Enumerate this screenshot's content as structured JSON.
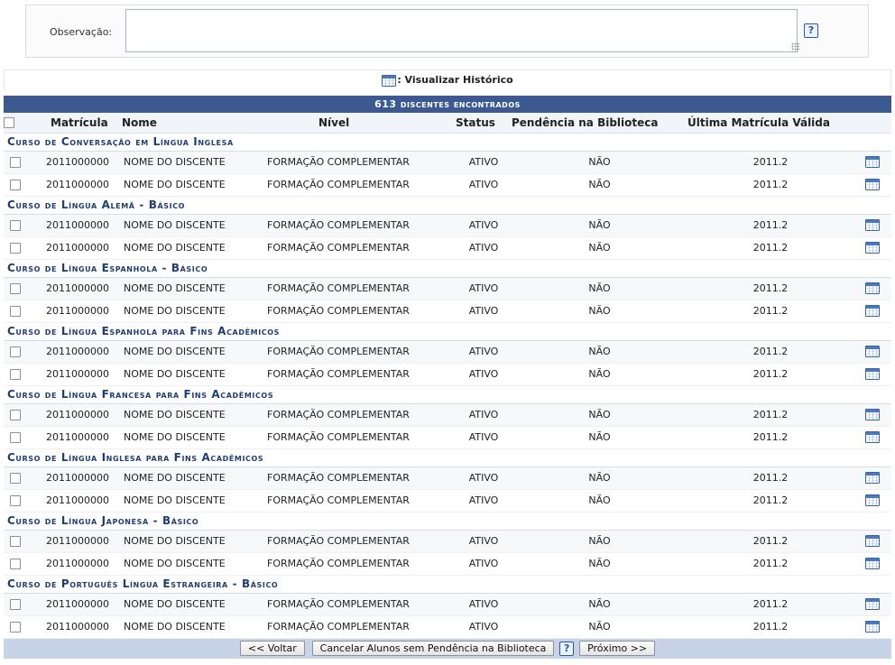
{
  "observation": {
    "label": "Observação:",
    "value": "",
    "help": "?"
  },
  "legend": {
    "icon": "calendar-list-icon",
    "label": ": Visualizar Histórico"
  },
  "table": {
    "caption": "613 discentes encontrados",
    "columns": [
      "Matrícula",
      "Nome",
      "Nível",
      "Status",
      "Pendência na Biblioteca",
      "Última Matrícula Válida"
    ],
    "groups": [
      {
        "title": "Curso de Conversação em Língua Inglesa",
        "rows": [
          {
            "matricula": "2011000000",
            "nome": "NOME DO DISCENTE",
            "nivel": "FORMAÇÃO COMPLEMENTAR",
            "status": "ATIVO",
            "pendencia": "NÃO",
            "ultima": "2011.2"
          },
          {
            "matricula": "2011000000",
            "nome": "NOME DO DISCENTE",
            "nivel": "FORMAÇÃO COMPLEMENTAR",
            "status": "ATIVO",
            "pendencia": "NÃO",
            "ultima": "2011.2"
          }
        ]
      },
      {
        "title": "Curso de Língua Alemã - Básico",
        "rows": [
          {
            "matricula": "2011000000",
            "nome": "NOME DO DISCENTE",
            "nivel": "FORMAÇÃO COMPLEMENTAR",
            "status": "ATIVO",
            "pendencia": "NÃO",
            "ultima": "2011.2"
          },
          {
            "matricula": "2011000000",
            "nome": "NOME DO DISCENTE",
            "nivel": "FORMAÇÃO COMPLEMENTAR",
            "status": "ATIVO",
            "pendencia": "NÃO",
            "ultima": "2011.2"
          }
        ]
      },
      {
        "title": "Curso de Língua Espanhola - Básico",
        "rows": [
          {
            "matricula": "2011000000",
            "nome": "NOME DO DISCENTE",
            "nivel": "FORMAÇÃO COMPLEMENTAR",
            "status": "ATIVO",
            "pendencia": "NÃO",
            "ultima": "2011.2"
          },
          {
            "matricula": "2011000000",
            "nome": "NOME DO DISCENTE",
            "nivel": "FORMAÇÃO COMPLEMENTAR",
            "status": "ATIVO",
            "pendencia": "NÃO",
            "ultima": "2011.2"
          }
        ]
      },
      {
        "title": "Curso de Língua Espanhola para Fins Acadêmicos",
        "rows": [
          {
            "matricula": "2011000000",
            "nome": "NOME DO DISCENTE",
            "nivel": "FORMAÇÃO COMPLEMENTAR",
            "status": "ATIVO",
            "pendencia": "NÃO",
            "ultima": "2011.2"
          },
          {
            "matricula": "2011000000",
            "nome": "NOME DO DISCENTE",
            "nivel": "FORMAÇÃO COMPLEMENTAR",
            "status": "ATIVO",
            "pendencia": "NÃO",
            "ultima": "2011.2"
          }
        ]
      },
      {
        "title": "Curso de Língua Francesa para Fins Acadêmicos",
        "rows": [
          {
            "matricula": "2011000000",
            "nome": "NOME DO DISCENTE",
            "nivel": "FORMAÇÃO COMPLEMENTAR",
            "status": "ATIVO",
            "pendencia": "NÃO",
            "ultima": "2011.2"
          },
          {
            "matricula": "2011000000",
            "nome": "NOME DO DISCENTE",
            "nivel": "FORMAÇÃO COMPLEMENTAR",
            "status": "ATIVO",
            "pendencia": "NÃO",
            "ultima": "2011.2"
          }
        ]
      },
      {
        "title": "Curso de Língua Inglesa para Fins Acadêmicos",
        "rows": [
          {
            "matricula": "2011000000",
            "nome": "NOME DO DISCENTE",
            "nivel": "FORMAÇÃO COMPLEMENTAR",
            "status": "ATIVO",
            "pendencia": "NÃO",
            "ultima": "2011.2"
          },
          {
            "matricula": "2011000000",
            "nome": "NOME DO DISCENTE",
            "nivel": "FORMAÇÃO COMPLEMENTAR",
            "status": "ATIVO",
            "pendencia": "NÃO",
            "ultima": "2011.2"
          }
        ]
      },
      {
        "title": "Curso de Língua Japonesa - Básico",
        "rows": [
          {
            "matricula": "2011000000",
            "nome": "NOME DO DISCENTE",
            "nivel": "FORMAÇÃO COMPLEMENTAR",
            "status": "ATIVO",
            "pendencia": "NÃO",
            "ultima": "2011.2"
          },
          {
            "matricula": "2011000000",
            "nome": "NOME DO DISCENTE",
            "nivel": "FORMAÇÃO COMPLEMENTAR",
            "status": "ATIVO",
            "pendencia": "NÃO",
            "ultima": "2011.2"
          }
        ]
      },
      {
        "title": "Curso de Português Língua Estrangeira - Básico",
        "rows": [
          {
            "matricula": "2011000000",
            "nome": "NOME DO DISCENTE",
            "nivel": "FORMAÇÃO COMPLEMENTAR",
            "status": "ATIVO",
            "pendencia": "NÃO",
            "ultima": "2011.2"
          },
          {
            "matricula": "2011000000",
            "nome": "NOME DO DISCENTE",
            "nivel": "FORMAÇÃO COMPLEMENTAR",
            "status": "ATIVO",
            "pendencia": "NÃO",
            "ultima": "2011.2"
          }
        ]
      }
    ]
  },
  "footer": {
    "back_label": "<< Voltar",
    "cancel_label": "Cancelar Alunos sem Pendência na Biblioteca",
    "help": "?",
    "next_label": "Próximo >>"
  },
  "colors": {
    "caption_bg": "#3c5a91",
    "group_text": "#1f3d73",
    "footer_bg": "#c8d3e8"
  }
}
